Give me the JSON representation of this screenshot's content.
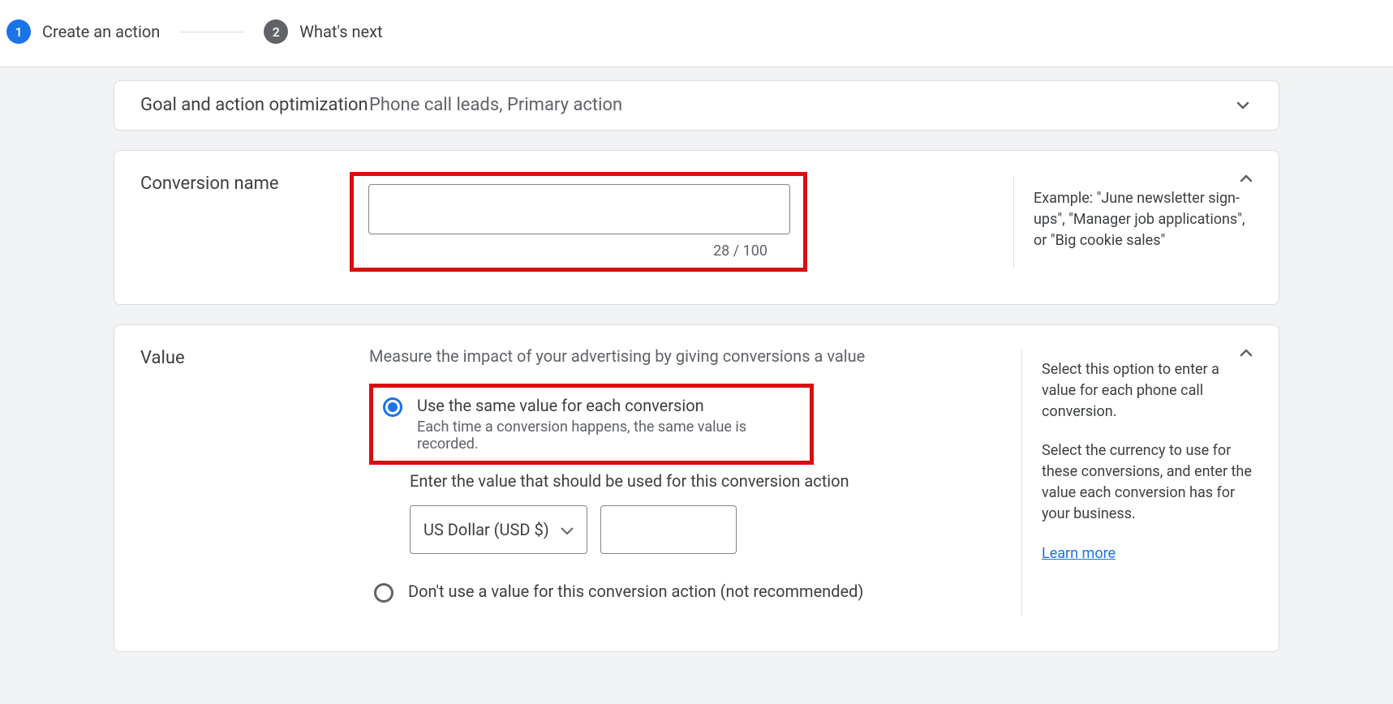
{
  "stepper": {
    "step1": {
      "num": "1",
      "label": "Create an action"
    },
    "step2": {
      "num": "2",
      "label": "What's next"
    }
  },
  "goal": {
    "label": "Goal and action optimization",
    "value": "Phone call leads, Primary action"
  },
  "conversion_name": {
    "label": "Conversion name",
    "value": "",
    "char_count": "28 / 100",
    "example": "Example: \"June newsletter sign-ups\", \"Manager job applications\", or \"Big cookie sales\""
  },
  "value_section": {
    "label": "Value",
    "description": "Measure the impact of your advertising by giving conversions a value",
    "same_value": {
      "title": "Use the same value for each conversion",
      "sub": "Each time a conversion happens, the same value is recorded."
    },
    "enter_label": "Enter the value that should be used for this conversion action",
    "currency_selected": "US Dollar (USD $)",
    "amount": "",
    "no_value": {
      "title": "Don't use a value for this conversion action (not recommended)"
    },
    "help1": "Select this option to enter a value for each phone call conversion.",
    "help2": "Select the currency to use for these conversions, and enter the value each conversion has for your business.",
    "learn_more": "Learn more"
  }
}
